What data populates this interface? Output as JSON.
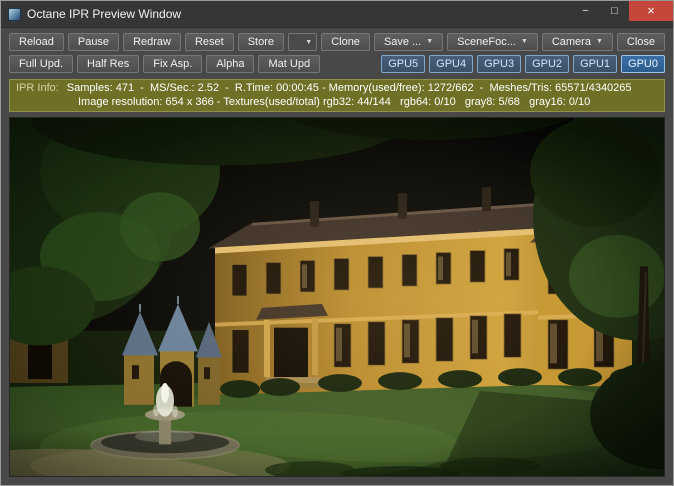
{
  "window": {
    "title": "Octane IPR Preview Window",
    "controls": {
      "minimize": "−",
      "maximize": "□",
      "close": "×"
    }
  },
  "toolbar_row1": {
    "reload": "Reload",
    "pause": "Pause",
    "redraw": "Redraw",
    "reset": "Reset",
    "store": "Store",
    "store_combo_value": "",
    "clone": "Clone",
    "save": "Save ...",
    "scene_focus": "SceneFoc...",
    "camera": "Camera",
    "close": "Close",
    "dropdown_glyph": "▼"
  },
  "toolbar_row2": {
    "full_update": "Full Upd.",
    "half_res": "Half Res",
    "fix_aspect": "Fix Asp.",
    "alpha": "Alpha",
    "mat_update": "Mat Upd",
    "gpu_buttons": [
      "GPU5",
      "GPU4",
      "GPU3",
      "GPU2",
      "GPU1",
      "GPU0"
    ]
  },
  "ipr_info": {
    "label": "IPR Info:",
    "line1": "Samples: 471  -  MS/Sec.: 2.52  -  R.Time: 00:00:45 - Memory(used/free): 1272/662  -  Meshes/Tris: 65571/4340265",
    "line2": "Image resolution: 654 x 366 - Textures(used/total) rgb32: 44/144   rgb64: 0/10   gray8: 5/68   gray16: 0/10"
  },
  "colors": {
    "info_bar_background": "#6f6f26",
    "gpu_button_accent": "#7fa8cf",
    "close_button_red": "#c4473a"
  }
}
